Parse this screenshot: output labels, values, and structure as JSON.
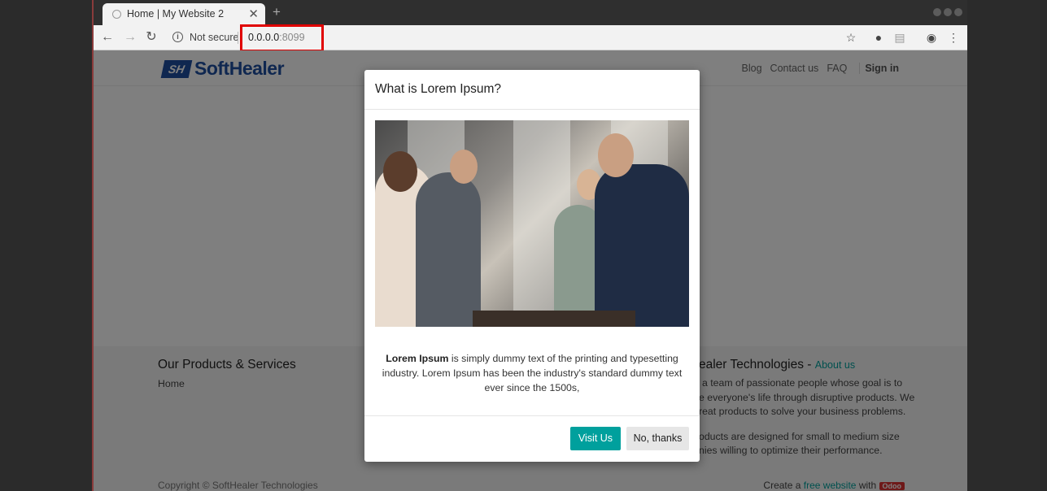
{
  "browser": {
    "tab_title": "Home | My Website 2",
    "tab_close": "✕",
    "new_tab": "+",
    "not_secure": "Not secure",
    "url_host": "0.0.0.0",
    "url_port": ":8099"
  },
  "site": {
    "logo_mark": "SH",
    "logo_text": "SoftHealer",
    "menu": [
      "Blog",
      "Contact us",
      "FAQ"
    ],
    "sign_in": "Sign in"
  },
  "footer": {
    "products_title": "Our Products & Services",
    "home_link": "Home",
    "about_title_prefix": "ealer Technologies - ",
    "about_link": "About us",
    "about_text_1": "a team of passionate people whose goal is to",
    "about_text_2": "e everyone's life through disruptive products. We",
    "about_text_3": "reat products to solve your business problems.",
    "about_text_4": "oducts are designed for small to medium size",
    "about_text_5": "nies willing to optimize their performance.",
    "copyright": "Copyright © SoftHealer Technologies",
    "create_prefix": "Create a ",
    "create_link": "free website",
    "create_suffix": " with ",
    "odoo_badge": "Odoo"
  },
  "modal": {
    "title": "What is Lorem Ipsum?",
    "body_bold": "Lorem Ipsum",
    "body_text": " is simply dummy text of the printing and typesetting industry. Lorem Ipsum has been the industry's standard dummy text ever since the 1500s,",
    "visit_label": "Visit Us",
    "no_label": "No, thanks"
  },
  "colors": {
    "accent": "#00a09d",
    "brand": "#1f4fa0",
    "highlight": "#e00000"
  }
}
